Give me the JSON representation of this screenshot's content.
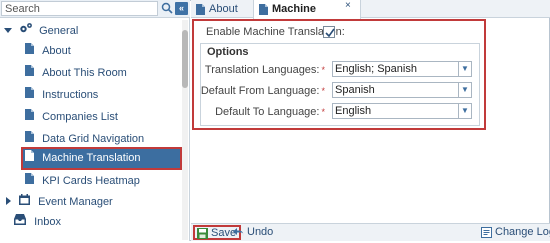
{
  "sidebar": {
    "search_placeholder": "Search",
    "collapse_label": "«",
    "tree": {
      "general": "General",
      "about": "About",
      "about_room": "About This Room",
      "instructions": "Instructions",
      "companies": "Companies List",
      "datagrid": "Data Grid Navigation",
      "mt": "Machine Translation",
      "kpi": "KPI Cards Heatmap",
      "event_manager": "Event Manager",
      "inbox": "Inbox"
    }
  },
  "tabs": {
    "about": "About",
    "mt": "Machine Translation",
    "close": "×"
  },
  "form": {
    "enable_label": "Enable Machine Translation:",
    "enable_checked": true,
    "options_title": "Options",
    "translation_languages_label": "Translation Languages:",
    "translation_languages_value": "English; Spanish",
    "default_from_label": "Default From Language:",
    "default_from_value": "Spanish",
    "default_to_label": "Default To Language:",
    "default_to_value": "English",
    "required_mark": "*"
  },
  "footer": {
    "save": "Save",
    "undo": "Undo",
    "changelog": "Change Log"
  },
  "colors": {
    "accent": "#3c6ea0",
    "highlight_border": "#c13a3a",
    "link": "#2a4e77"
  }
}
